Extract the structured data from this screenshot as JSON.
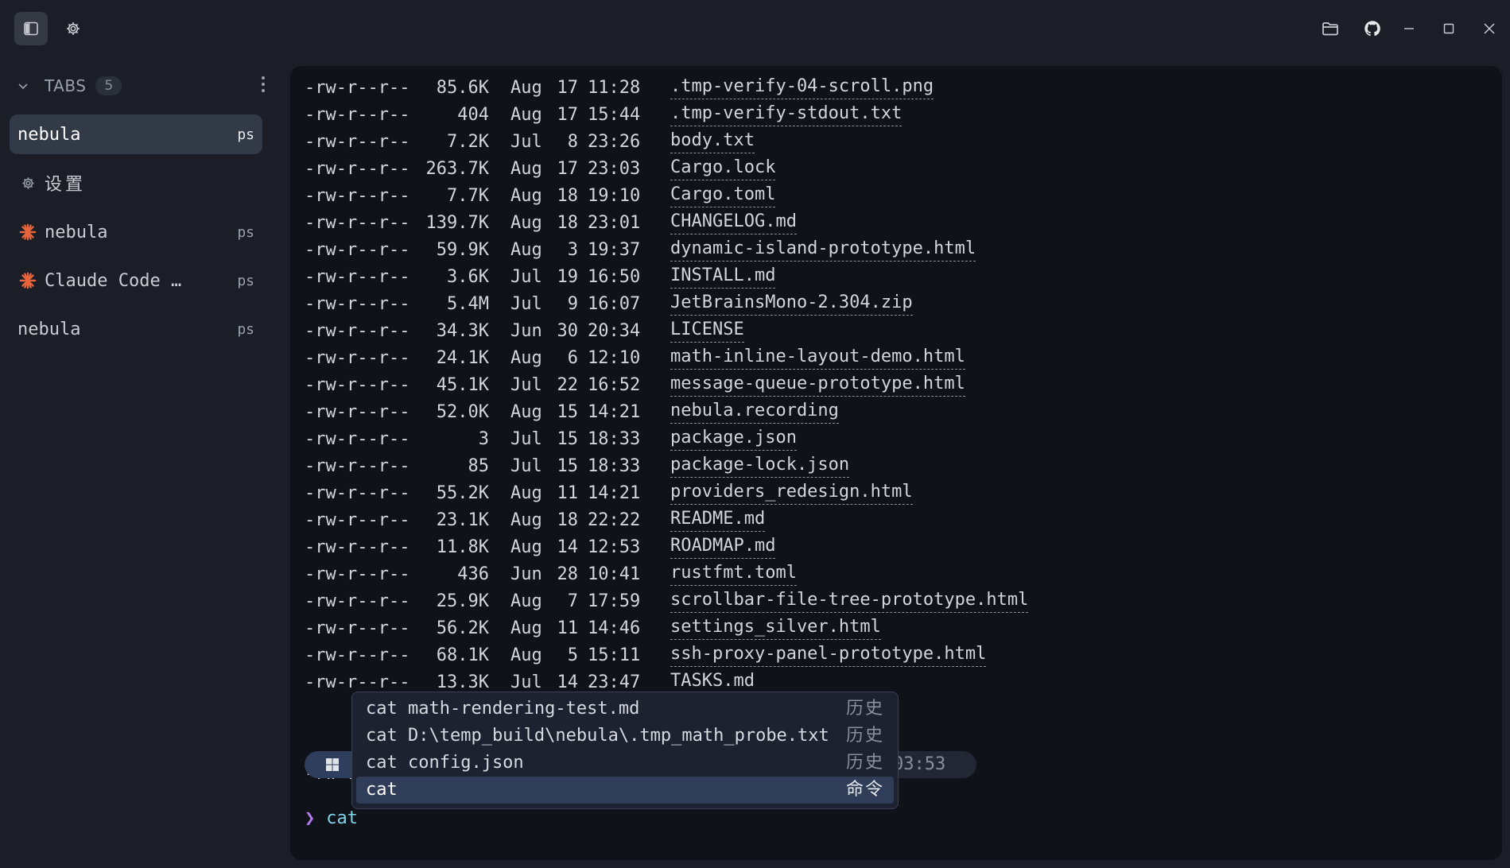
{
  "sidebar": {
    "tabs_title": "TABS",
    "tabs_count": "5",
    "items": [
      {
        "label": "nebula",
        "badge": "ps",
        "icon": "none",
        "active": true
      },
      {
        "label": "设置",
        "badge": "",
        "icon": "gear-icon",
        "active": false
      },
      {
        "label": "nebula",
        "badge": "ps",
        "icon": "claude-asterisk-icon",
        "active": false
      },
      {
        "label": "Claude Code …",
        "badge": "ps",
        "icon": "claude-asterisk-icon",
        "active": false
      },
      {
        "label": "nebula",
        "badge": "ps",
        "icon": "none",
        "active": false
      }
    ]
  },
  "colors": {
    "accent_orange": "#e8643c",
    "prompt_symbol": "#b07cf0",
    "prompt_command": "#7fd4e8",
    "selection": "#2f3d59"
  },
  "listing": [
    {
      "perm": "-rw-r--r--",
      "size": "85.6K",
      "month": "Aug",
      "day": "17",
      "time": "11:28",
      "name": ".tmp-verify-04-scroll.png",
      "link": true
    },
    {
      "perm": "-rw-r--r--",
      "size": "404",
      "month": "Aug",
      "day": "17",
      "time": "15:44",
      "name": ".tmp-verify-stdout.txt",
      "link": true
    },
    {
      "perm": "-rw-r--r--",
      "size": "7.2K",
      "month": "Jul",
      "day": "8",
      "time": "23:26",
      "name": "body.txt",
      "link": true
    },
    {
      "perm": "-rw-r--r--",
      "size": "263.7K",
      "month": "Aug",
      "day": "17",
      "time": "23:03",
      "name": "Cargo.lock",
      "link": true
    },
    {
      "perm": "-rw-r--r--",
      "size": "7.7K",
      "month": "Aug",
      "day": "18",
      "time": "19:10",
      "name": "Cargo.toml",
      "link": true
    },
    {
      "perm": "-rw-r--r--",
      "size": "139.7K",
      "month": "Aug",
      "day": "18",
      "time": "23:01",
      "name": "CHANGELOG.md",
      "link": true
    },
    {
      "perm": "-rw-r--r--",
      "size": "59.9K",
      "month": "Aug",
      "day": "3",
      "time": "19:37",
      "name": "dynamic-island-prototype.html",
      "link": true
    },
    {
      "perm": "-rw-r--r--",
      "size": "3.6K",
      "month": "Jul",
      "day": "19",
      "time": "16:50",
      "name": "INSTALL.md",
      "link": true
    },
    {
      "perm": "-rw-r--r--",
      "size": "5.4M",
      "month": "Jul",
      "day": "9",
      "time": "16:07",
      "name": "JetBrainsMono-2.304.zip",
      "link": true
    },
    {
      "perm": "-rw-r--r--",
      "size": "34.3K",
      "month": "Jun",
      "day": "30",
      "time": "20:34",
      "name": "LICENSE",
      "link": true
    },
    {
      "perm": "-rw-r--r--",
      "size": "24.1K",
      "month": "Aug",
      "day": "6",
      "time": "12:10",
      "name": "math-inline-layout-demo.html",
      "link": true
    },
    {
      "perm": "-rw-r--r--",
      "size": "45.1K",
      "month": "Jul",
      "day": "22",
      "time": "16:52",
      "name": "message-queue-prototype.html",
      "link": true
    },
    {
      "perm": "-rw-r--r--",
      "size": "52.0K",
      "month": "Aug",
      "day": "15",
      "time": "14:21",
      "name": "nebula.recording",
      "link": true
    },
    {
      "perm": "-rw-r--r--",
      "size": "3",
      "month": "Jul",
      "day": "15",
      "time": "18:33",
      "name": "package.json",
      "link": true
    },
    {
      "perm": "-rw-r--r--",
      "size": "85",
      "month": "Jul",
      "day": "15",
      "time": "18:33",
      "name": "package-lock.json",
      "link": true
    },
    {
      "perm": "-rw-r--r--",
      "size": "55.2K",
      "month": "Aug",
      "day": "11",
      "time": "14:21",
      "name": "providers_redesign.html",
      "link": true
    },
    {
      "perm": "-rw-r--r--",
      "size": "23.1K",
      "month": "Aug",
      "day": "18",
      "time": "22:22",
      "name": "README.md",
      "link": true
    },
    {
      "perm": "-rw-r--r--",
      "size": "11.8K",
      "month": "Aug",
      "day": "14",
      "time": "12:53",
      "name": "ROADMAP.md",
      "link": true
    },
    {
      "perm": "-rw-r--r--",
      "size": "436",
      "month": "Jun",
      "day": "28",
      "time": "10:41",
      "name": "rustfmt.toml",
      "link": true
    },
    {
      "perm": "-rw-r--r--",
      "size": "25.9K",
      "month": "Aug",
      "day": "7",
      "time": "17:59",
      "name": "scrollbar-file-tree-prototype.html",
      "link": true
    },
    {
      "perm": "-rw-r--r--",
      "size": "56.2K",
      "month": "Aug",
      "day": "11",
      "time": "14:46",
      "name": "settings_silver.html",
      "link": true
    },
    {
      "perm": "-rw-r--r--",
      "size": "68.1K",
      "month": "Aug",
      "day": "5",
      "time": "15:11",
      "name": "ssh-proxy-panel-prototype.html",
      "link": true
    },
    {
      "perm": "-rw-r--r--",
      "size": "13.3K",
      "month": "Jul",
      "day": "14",
      "time": "23:47",
      "name": "TASKS.md",
      "link": false
    }
  ],
  "partial_line": "-rw-r",
  "prompt_bar_time": "03:53",
  "prompt": {
    "symbol": "❯",
    "command": "cat"
  },
  "suggestions": [
    {
      "text": "cat math-rendering-test.md",
      "kind": "历史",
      "selected": false
    },
    {
      "text": "cat D:\\temp_build\\nebula\\.tmp_math_probe.txt",
      "kind": "历史",
      "selected": false
    },
    {
      "text": "cat config.json",
      "kind": "历史",
      "selected": false
    },
    {
      "text": "cat",
      "kind": "命令",
      "selected": true
    }
  ]
}
